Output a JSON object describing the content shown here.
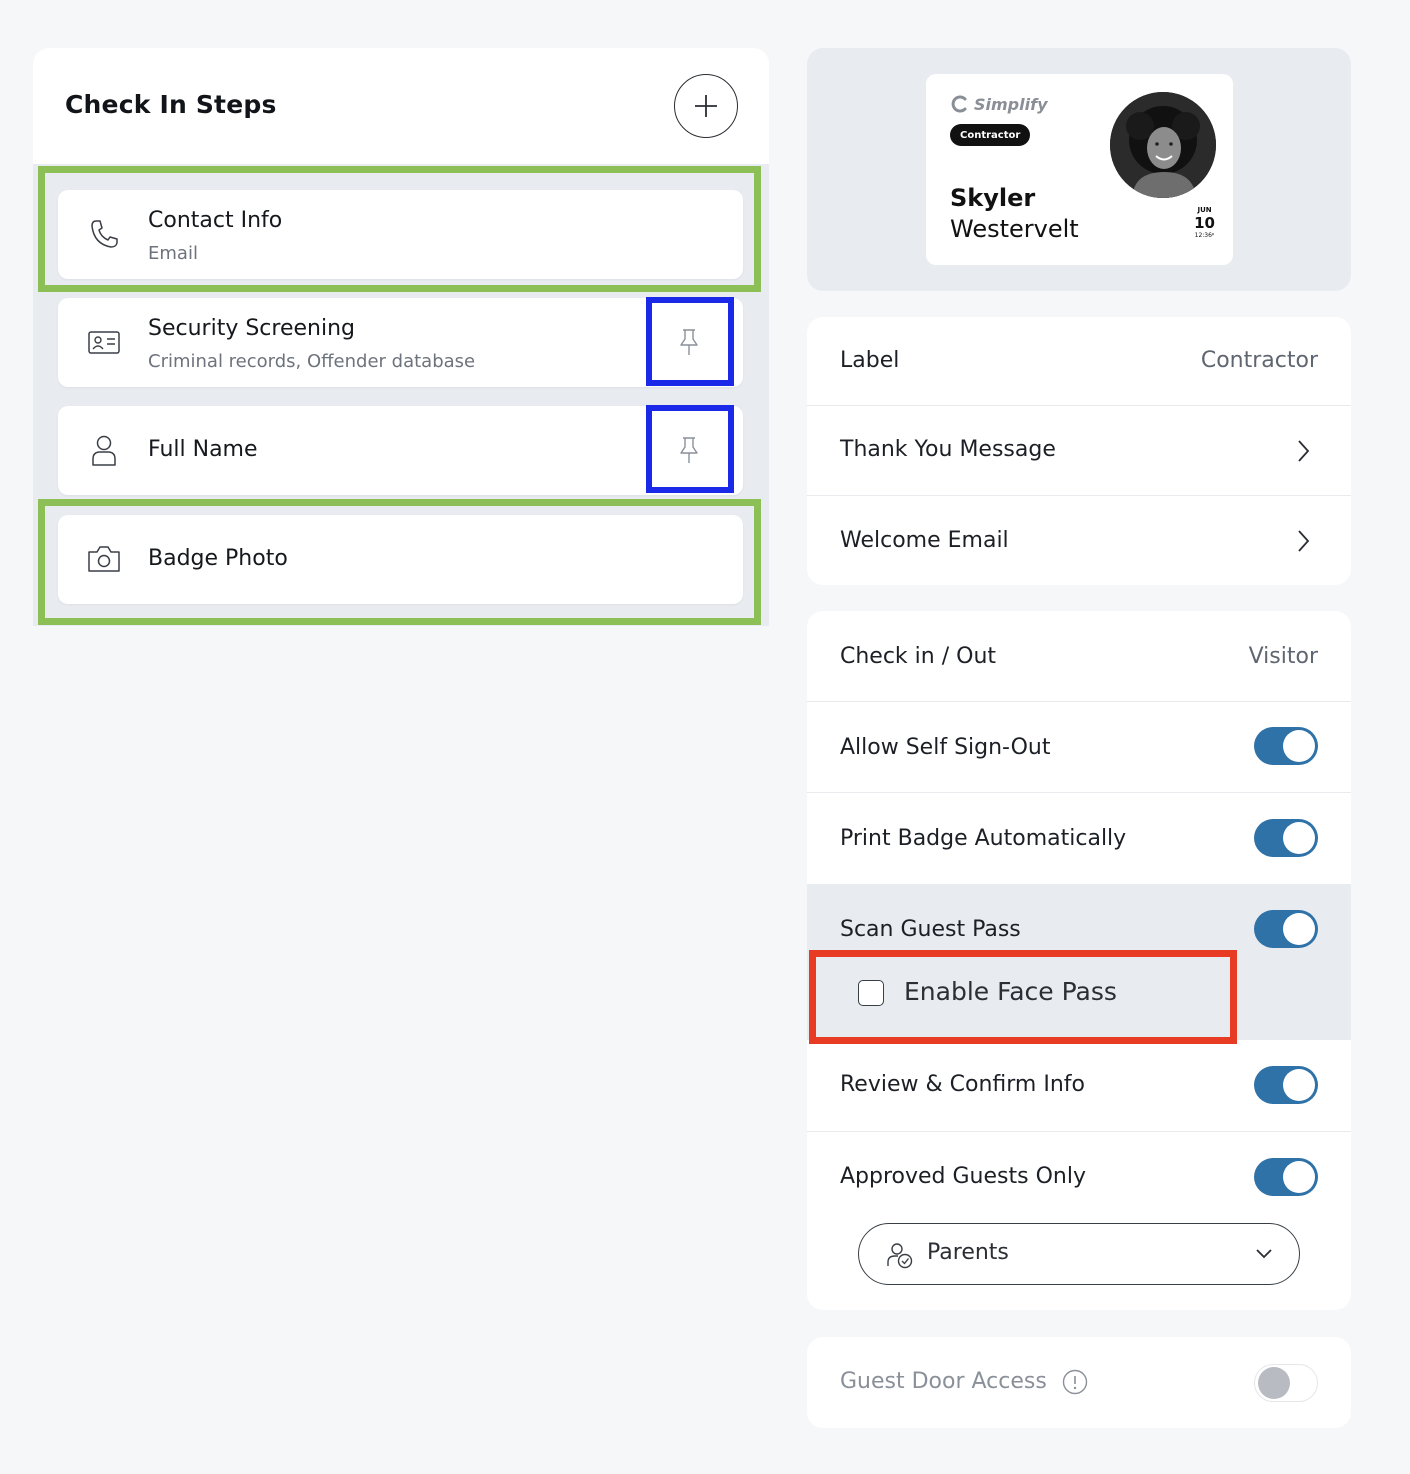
{
  "steps_panel": {
    "title": "Check In Steps",
    "add_button_icon": "plus-icon",
    "steps": [
      {
        "title": "Contact Info",
        "subtitle": "Email",
        "icon": "phone-icon"
      },
      {
        "title": "Security Screening",
        "subtitle": "Criminal records, Offender database",
        "icon": "id-card-icon"
      },
      {
        "title": "Full Name",
        "icon": "person-icon"
      },
      {
        "title": "Badge Photo",
        "icon": "camera-icon"
      }
    ]
  },
  "badge": {
    "logo": "Simplify",
    "pill": "Contractor",
    "first_name": "Skyler",
    "last_name": "Westervelt",
    "month": "JUN",
    "day": "10",
    "time": "12:36ᵖ"
  },
  "settings_card_1": {
    "label": {
      "label": "Label",
      "value": "Contractor"
    },
    "thank_you": {
      "label": "Thank You Message"
    },
    "welcome_email": {
      "label": "Welcome Email"
    }
  },
  "settings_card_2": {
    "check_in_out": {
      "label": "Check in / Out",
      "value": "Visitor"
    },
    "allow_self_signout": {
      "label": "Allow Self Sign-Out",
      "enabled": true
    },
    "print_badge": {
      "label": "Print Badge Automatically",
      "enabled": true
    },
    "scan_guest_pass": {
      "label": "Scan Guest Pass",
      "enabled": true
    },
    "enable_face_pass": {
      "label": "Enable Face Pass",
      "checked": false
    },
    "review_confirm": {
      "label": "Review & Confirm Info",
      "enabled": true
    },
    "approved_guests": {
      "label": "Approved Guests Only",
      "enabled": true,
      "group_selected": "Parents"
    }
  },
  "settings_card_3": {
    "guest_door_access": {
      "label": "Guest Door Access",
      "enabled": false
    }
  },
  "colors": {
    "toggle_on": "#2f72a8",
    "highlight_green": "#8cc057",
    "highlight_blue": "#1a28e8",
    "highlight_red": "#e83b24"
  }
}
